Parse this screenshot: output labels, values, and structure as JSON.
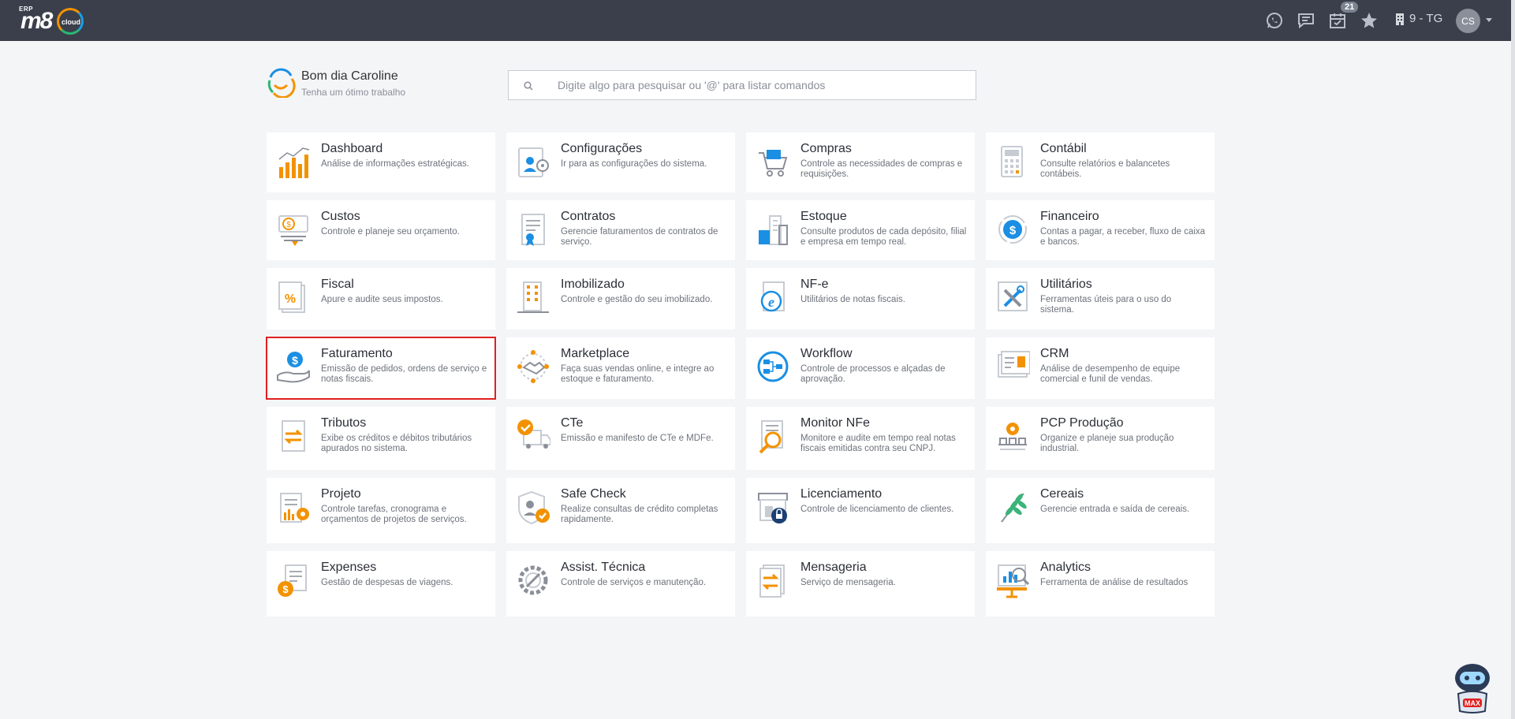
{
  "topbar": {
    "logo": {
      "erp": "ERP",
      "brand": "m8",
      "cloud": "cloud"
    },
    "icons": [
      "whatsapp-icon",
      "chat-icon",
      "calendar-icon",
      "star-icon"
    ],
    "notifications_count": "21",
    "company": "9 - TG",
    "user_initials": "CS"
  },
  "greeting": {
    "title": "Bom dia Caroline",
    "subtitle": "Tenha um ótimo trabalho"
  },
  "search": {
    "placeholder": "Digite algo para pesquisar ou '@' para listar comandos"
  },
  "colors": {
    "orange": "#f39200",
    "blue": "#1a8fe3",
    "selected_border": "#e02020",
    "topbar": "#3a3f4b"
  },
  "modules": [
    {
      "id": "dashboard",
      "title": "Dashboard",
      "desc": "Análise de informações estratégicas.",
      "icon": "bar-chart-icon"
    },
    {
      "id": "configuracoes",
      "title": "Configurações",
      "desc": "Ir para as configurações do sistema.",
      "icon": "settings-user-icon"
    },
    {
      "id": "compras",
      "title": "Compras",
      "desc": "Controle as necessidades de compras e requisições.",
      "icon": "shopping-cart-icon"
    },
    {
      "id": "contabil",
      "title": "Contábil",
      "desc": "Consulte relatórios e balancetes contábeis.",
      "icon": "calculator-icon"
    },
    {
      "id": "custos",
      "title": "Custos",
      "desc": "Controle e planeje seu orçamento.",
      "icon": "money-bill-icon"
    },
    {
      "id": "contratos",
      "title": "Contratos",
      "desc": "Gerencie faturamentos de contratos de serviço.",
      "icon": "contract-icon"
    },
    {
      "id": "estoque",
      "title": "Estoque",
      "desc": "Consulte produtos de cada depósito, filial e empresa em tempo real.",
      "icon": "warehouse-icon"
    },
    {
      "id": "financeiro",
      "title": "Financeiro",
      "desc": "Contas a pagar, a receber, fluxo de caixa e bancos.",
      "icon": "dollar-cycle-icon"
    },
    {
      "id": "fiscal",
      "title": "Fiscal",
      "desc": "Apure e audite seus impostos.",
      "icon": "percent-document-icon"
    },
    {
      "id": "imobilizado",
      "title": "Imobilizado",
      "desc": "Controle e gestão do seu imobilizado.",
      "icon": "building-icon"
    },
    {
      "id": "nfe",
      "title": "NF-e",
      "desc": "Utilitários de notas fiscais.",
      "icon": "e-document-icon"
    },
    {
      "id": "utilitarios",
      "title": "Utilitários",
      "desc": "Ferramentas úteis para o uso do sistema.",
      "icon": "tools-icon"
    },
    {
      "id": "faturamento",
      "title": "Faturamento",
      "desc": "Emissão de pedidos, ordens de serviço e notas fiscais.",
      "icon": "hand-dollar-icon",
      "selected": true
    },
    {
      "id": "marketplace",
      "title": "Marketplace",
      "desc": "Faça suas vendas online, e integre ao estoque e faturamento.",
      "icon": "handshake-icon"
    },
    {
      "id": "workflow",
      "title": "Workflow",
      "desc": "Controle de processos e alçadas de aprovação.",
      "icon": "workflow-icon"
    },
    {
      "id": "crm",
      "title": "CRM",
      "desc": "Análise de desempenho de equipe comercial e funil de vendas.",
      "icon": "contact-card-icon"
    },
    {
      "id": "tributos",
      "title": "Tributos",
      "desc": "Exibe os créditos e débitos tributários apurados no sistema.",
      "icon": "transfer-document-icon"
    },
    {
      "id": "cte",
      "title": "CTe",
      "desc": "Emissão e manifesto de CTe e MDFe.",
      "icon": "truck-check-icon"
    },
    {
      "id": "monitor-nfe",
      "title": "Monitor NFe",
      "desc": "Monitore e audite em tempo real notas fiscais emitidas contra seu CNPJ.",
      "icon": "magnifier-document-icon"
    },
    {
      "id": "pcp-producao",
      "title": "PCP Produção",
      "desc": "Organize e planeje sua produção industrial.",
      "icon": "production-gear-icon"
    },
    {
      "id": "projeto",
      "title": "Projeto",
      "desc": "Controle tarefas, cronograma e orçamentos de projetos de serviços.",
      "icon": "project-gear-icon"
    },
    {
      "id": "safe-check",
      "title": "Safe Check",
      "desc": "Realize consultas de crédito completas rapidamente.",
      "icon": "shield-check-icon"
    },
    {
      "id": "licenciamento",
      "title": "Licenciamento",
      "desc": "Controle de licenciamento de clientes.",
      "icon": "license-icon"
    },
    {
      "id": "cereais",
      "title": "Cereais",
      "desc": "Gerencie entrada e saída de cereais.",
      "icon": "wheat-icon"
    },
    {
      "id": "expenses",
      "title": "Expenses",
      "desc": "Gestão de despesas de viagens.",
      "icon": "expense-icon"
    },
    {
      "id": "assist-tecnica",
      "title": "Assist. Técnica",
      "desc": "Controle de serviços e manutenção.",
      "icon": "wrench-gear-icon"
    },
    {
      "id": "mensageria",
      "title": "Mensageria",
      "desc": "Serviço de mensageria.",
      "icon": "message-transfer-icon"
    },
    {
      "id": "analytics",
      "title": "Analytics",
      "desc": "Ferramenta de análise de resultados",
      "icon": "analytics-board-icon"
    }
  ],
  "assistant": {
    "label": "MAX"
  }
}
